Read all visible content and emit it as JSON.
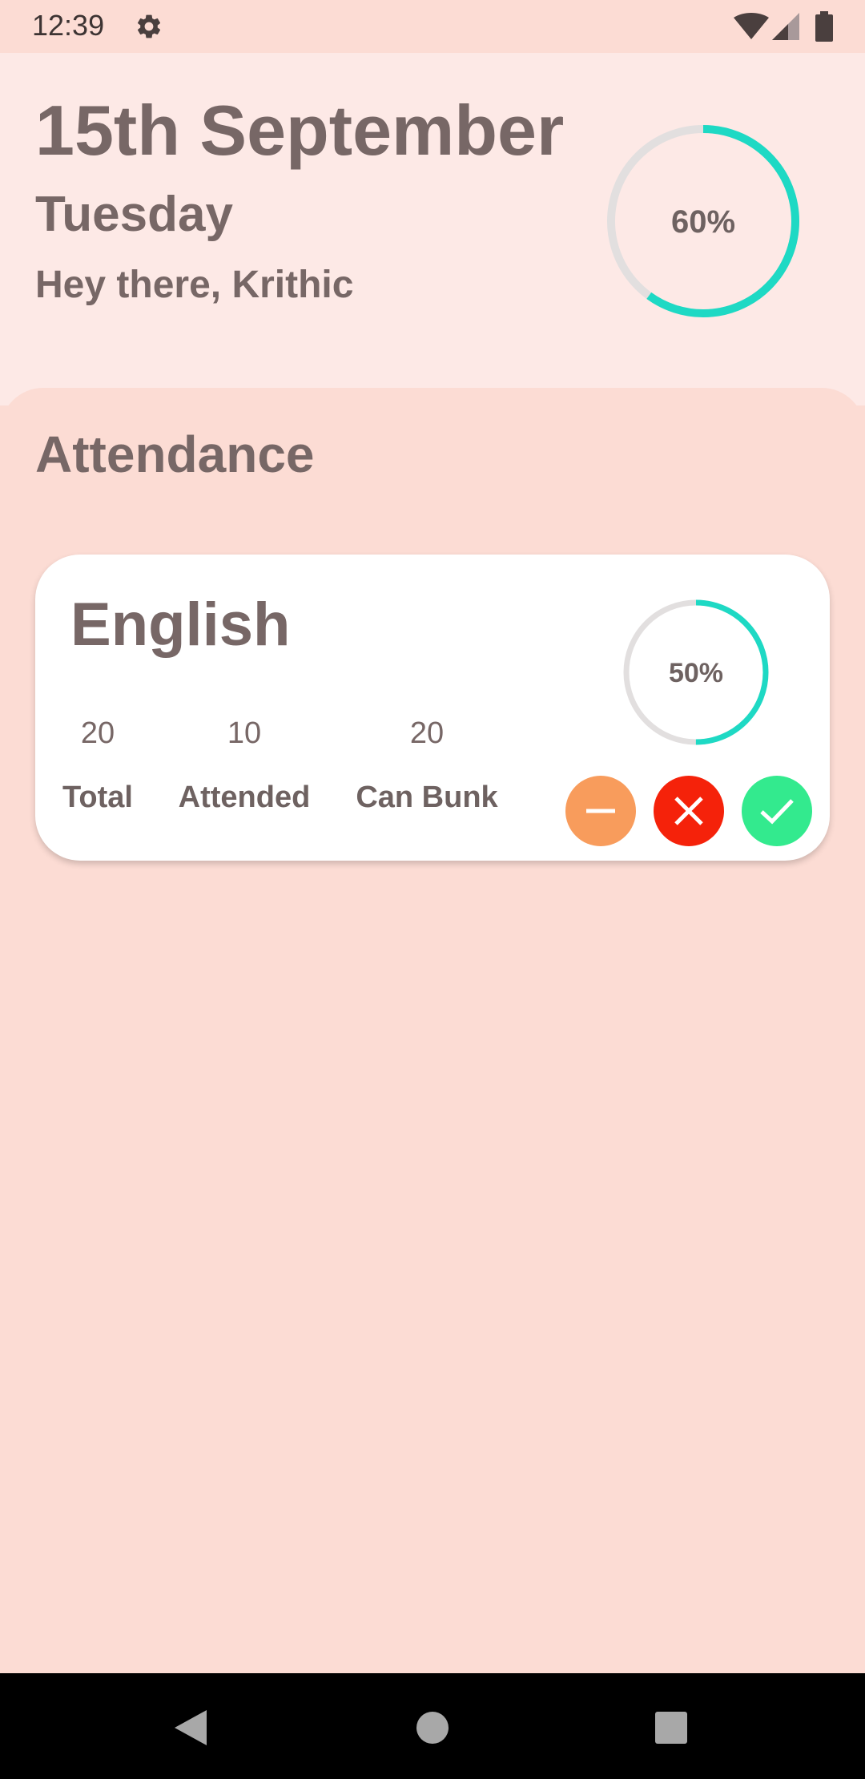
{
  "status_bar": {
    "time": "12:39",
    "icons": [
      "gear-icon",
      "wifi-icon",
      "signal-icon",
      "battery-icon"
    ]
  },
  "header": {
    "date": "15th September",
    "weekday": "Tuesday",
    "greeting": "Hey there, Krithic",
    "overall_percent_label": "60%",
    "overall_percent": 0.6
  },
  "attendance": {
    "title": "Attendance",
    "subjects": [
      {
        "name": "English",
        "percent_label": "50%",
        "percent": 0.5,
        "total": "20",
        "total_label": "Total",
        "attended": "10",
        "attended_label": "Attended",
        "can_bunk": "20",
        "can_bunk_label": "Can Bunk",
        "actions": [
          "minus-icon",
          "close-icon",
          "check-icon"
        ]
      }
    ]
  },
  "colors": {
    "background": "#fcdcd4",
    "header_background": "#fde9e6",
    "text": "#776766",
    "ring_progress": "#1ed9c4",
    "ring_track": "#e2dfdf",
    "unmark": "#f89c5c",
    "absent": "#f5220a",
    "present": "#33ea8e"
  },
  "nav_bar": {
    "icons": [
      "back-icon",
      "home-icon",
      "recents-icon"
    ]
  }
}
